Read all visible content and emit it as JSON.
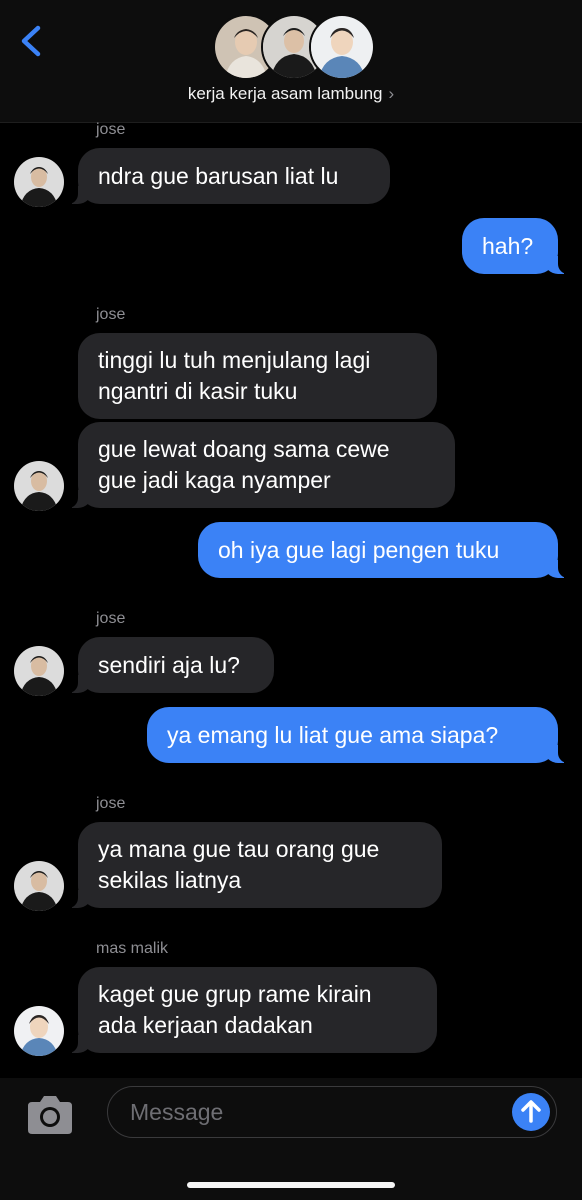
{
  "header": {
    "group_name": "kerja kerja asam lambung",
    "chevron": "›"
  },
  "colors": {
    "incoming_bubble": "#262629",
    "outgoing_bubble": "#3b82f6",
    "background": "#000000",
    "accent": "#3b82f6"
  },
  "messages": [
    {
      "sender": "jose"
    },
    {
      "text": "ndra gue barusan liat lu"
    },
    {
      "text": "hah?"
    },
    {
      "sender": "jose"
    },
    {
      "text": "tinggi lu tuh menjulang lagi\nngantri di kasir tuku"
    },
    {
      "text": "gue lewat doang sama cewe\ngue jadi kaga nyamper"
    },
    {
      "text": "oh iya gue lagi pengen tuku"
    },
    {
      "sender": "jose"
    },
    {
      "text": "sendiri aja lu?"
    },
    {
      "text": "ya emang lu liat gue ama siapa?"
    },
    {
      "sender": "jose"
    },
    {
      "text": "ya mana gue tau orang gue\nsekilas liatnya"
    },
    {
      "sender": "mas malik"
    },
    {
      "text": "kaget gue grup rame kirain\nada kerjaan dadakan"
    }
  ],
  "composer": {
    "placeholder": "Message"
  },
  "icons": {
    "back": "chevron-left-icon",
    "camera": "camera-icon",
    "send": "arrow-up-icon"
  }
}
